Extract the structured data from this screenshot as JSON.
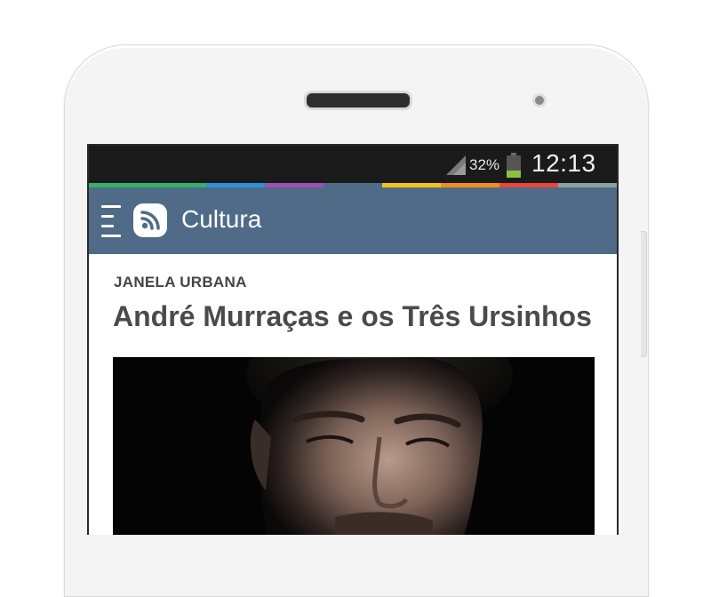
{
  "status_bar": {
    "battery_percent": "32%",
    "battery_level": 0.32,
    "time": "12:13"
  },
  "color_stripe": [
    "#3aae6a",
    "#3aae6a",
    "#2f8fd8",
    "#9b51b8",
    "#4f6b87",
    "#f2c21b",
    "#f28c1c",
    "#e8453c",
    "#8aa3a0"
  ],
  "app_bar": {
    "title": "Cultura",
    "background": "#4f6b87"
  },
  "article": {
    "kicker": "JANELA URBANA",
    "headline": "André Murraças e os Três Ursinhos",
    "image": "portrait-photo"
  }
}
